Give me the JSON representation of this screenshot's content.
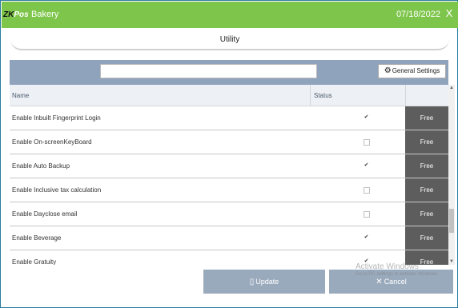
{
  "titlebar": {
    "logo_zk": "ZK",
    "logo_pos": "Pos",
    "app_title": "Bakery",
    "date": "07/18/2022",
    "close_glyph": "X"
  },
  "section": {
    "title": "Utility"
  },
  "toolbar": {
    "search_value": "",
    "search_placeholder": "",
    "settings_icon": "gear-icon",
    "settings_label": "General Settings"
  },
  "table": {
    "headers": {
      "name": "Name",
      "status": "Status",
      "action": ""
    },
    "rows": [
      {
        "name": "Enable Inbuilt Fingerprint Login",
        "checked": true,
        "action": "Free"
      },
      {
        "name": "Enable On-screenKeyBoard",
        "checked": false,
        "action": "Free"
      },
      {
        "name": "Enable Auto Backup",
        "checked": true,
        "action": "Free"
      },
      {
        "name": "Enable Inclusive tax calculation",
        "checked": false,
        "action": "Free"
      },
      {
        "name": "Enable Dayclose email",
        "checked": false,
        "action": "Free"
      },
      {
        "name": "Enable Beverage",
        "checked": true,
        "action": "Free"
      },
      {
        "name": "Enable Gratuity",
        "checked": true,
        "action": "Free"
      }
    ]
  },
  "footer": {
    "update_label": "Update",
    "update_icon": "phone-icon",
    "cancel_label": "Cancel",
    "cancel_icon": "x-icon"
  },
  "watermark": {
    "title": "Activate Windows",
    "subtitle": "Go to PC settings to activate Windows."
  },
  "colors": {
    "titlebar": "#7ec54b",
    "toolbar": "#8fa3bd",
    "free_button": "#5d5d5d",
    "footer_button": "#9aaabd"
  }
}
